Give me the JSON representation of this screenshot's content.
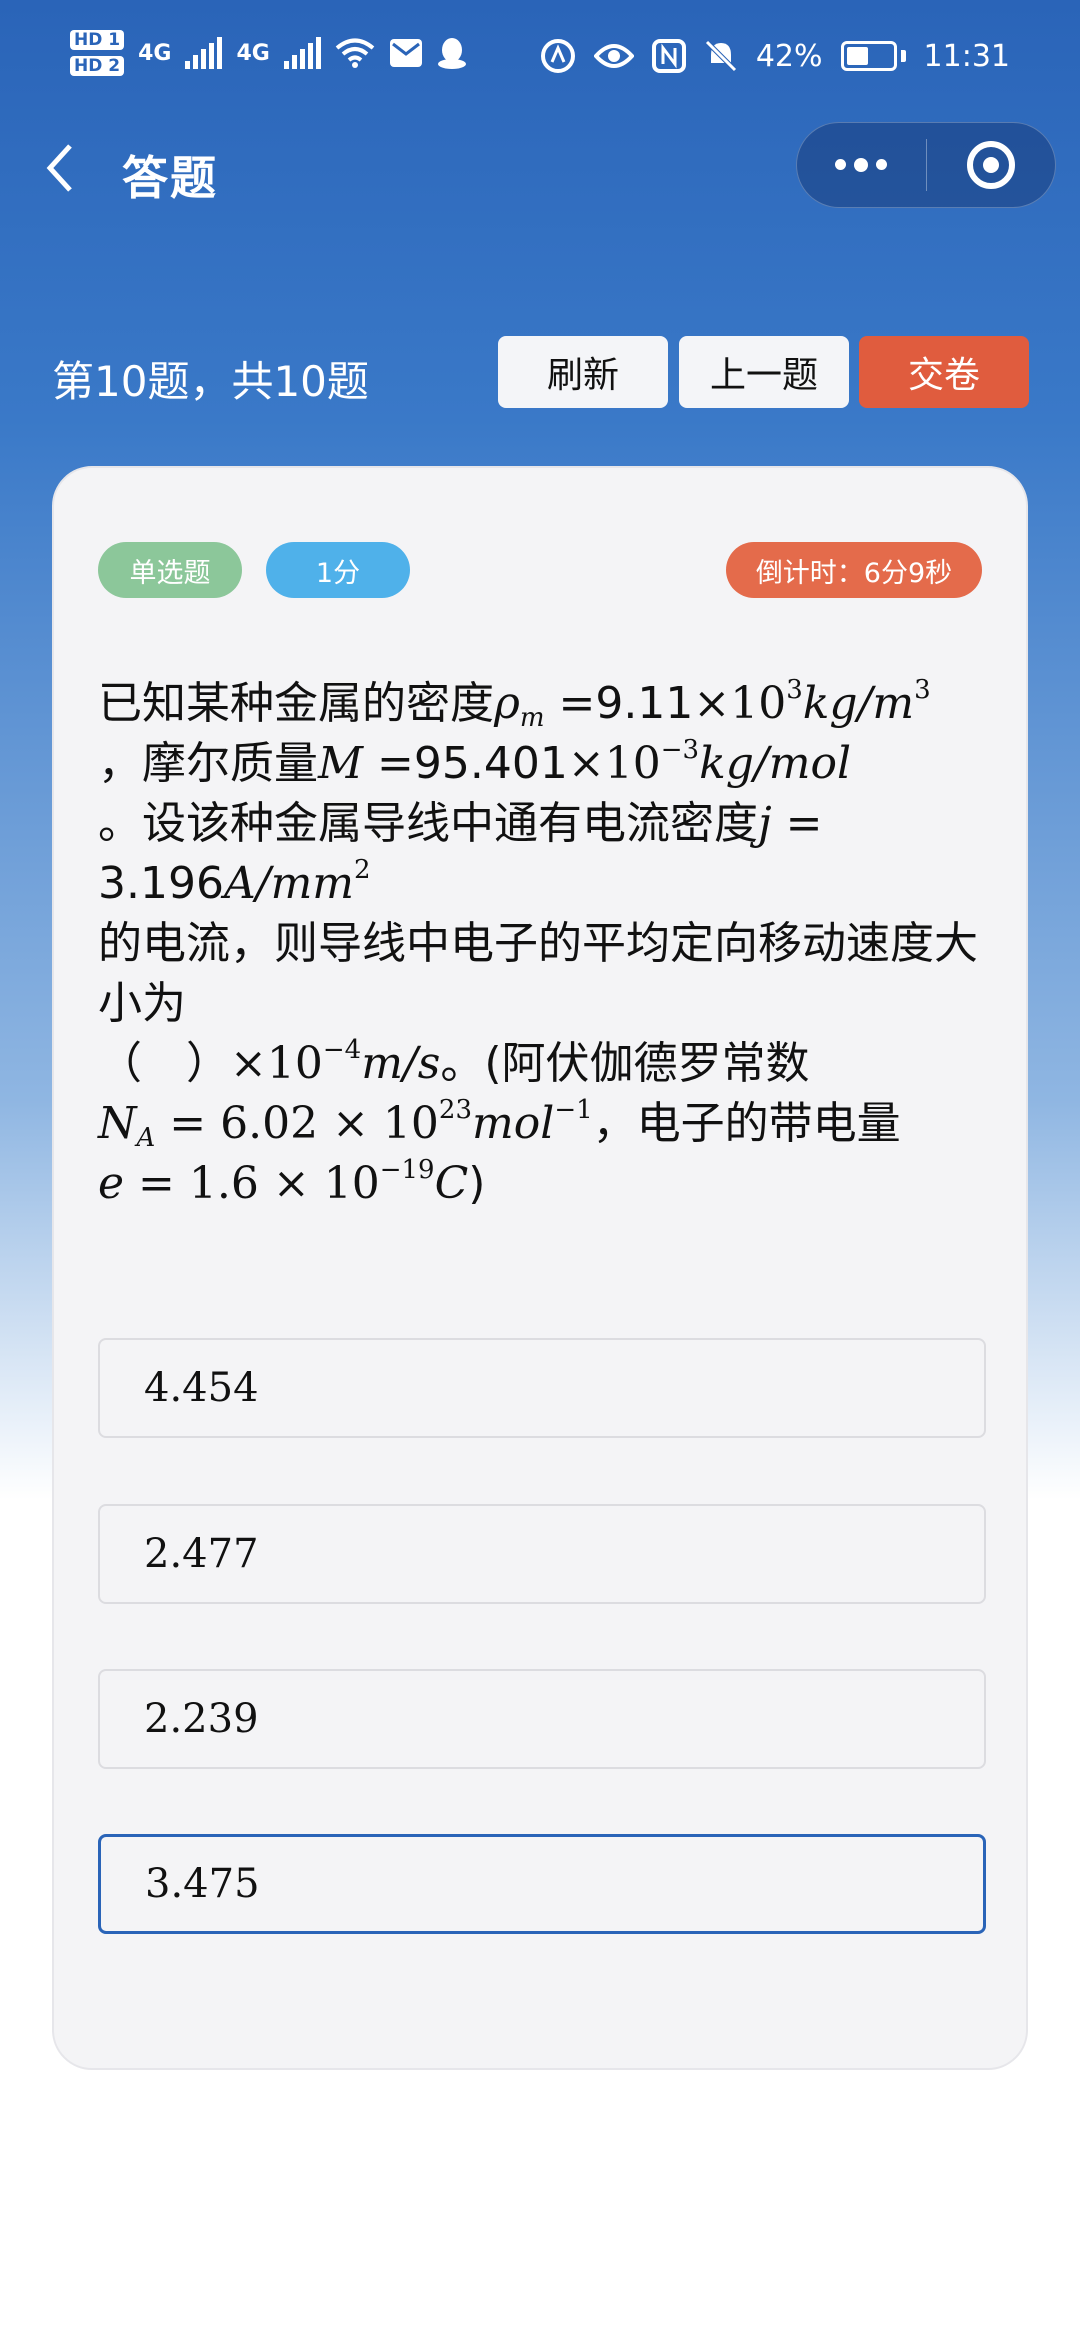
{
  "status_bar": {
    "hd1": "HD 1",
    "hd2": "HD 2",
    "net1": "4G",
    "net2": "4G",
    "battery": "42%",
    "time": "11:31"
  },
  "nav": {
    "title": "答题",
    "back_icon": "chevron-left-icon",
    "more_icon": "more-dots-icon",
    "close_icon": "target-circle-icon"
  },
  "header": {
    "progress": "第10题，共10题",
    "refresh_label": "刷新",
    "prev_label": "上一题",
    "submit_label": "交卷"
  },
  "card": {
    "type_tag": "单选题",
    "score_tag": "1分",
    "timer": "倒计时：6分9秒"
  },
  "question": {
    "p1": "已知某种金属的密度",
    "rho": "ρ",
    "rho_sub": "m",
    "eq1": " =",
    "val1": "9.11",
    "times1": "×10",
    "exp1": "3",
    "unit1": "kg/m",
    "unit1_exp": "3",
    "p2": "，摩尔质量",
    "M": "M",
    "eq2": " =",
    "val2": "95.401",
    "times2": "×10",
    "exp2": "−3",
    "unit2": "kg/mol",
    "p3": "。设该种金属导线中通有电流密度",
    "j": "j",
    "eq3": " =",
    "val3": "3.196",
    "unit3": "A/mm",
    "unit3_exp": "2",
    "p4": "的电流，则导线中电子的平均定向移动速度大小为",
    "blank": "（　）",
    "times4": "×10",
    "exp4": "−4",
    "unit4": "m/s",
    "p5": "。(阿伏伽德罗常数",
    "NA": "N",
    "NA_sub": "A",
    "NA_val": " = 6.02 × 10",
    "NA_exp": "23",
    "NA_unit": "mol",
    "NA_unit_exp": "−1",
    "p6": "，电子的带电量",
    "e": "e",
    "e_val": " = 1.6 × 10",
    "e_exp": "−19",
    "e_unit": "C",
    "p7": ")"
  },
  "options": [
    {
      "label": "4.454",
      "selected": false
    },
    {
      "label": "2.477",
      "selected": false
    },
    {
      "label": "2.239",
      "selected": false
    },
    {
      "label": "3.475",
      "selected": true
    }
  ],
  "colors": {
    "primary": "#2a64b8",
    "submit": "#e05c3e",
    "tag_type": "#8cc79a",
    "tag_score": "#4fb1ea",
    "tag_timer": "#e46b4b"
  }
}
